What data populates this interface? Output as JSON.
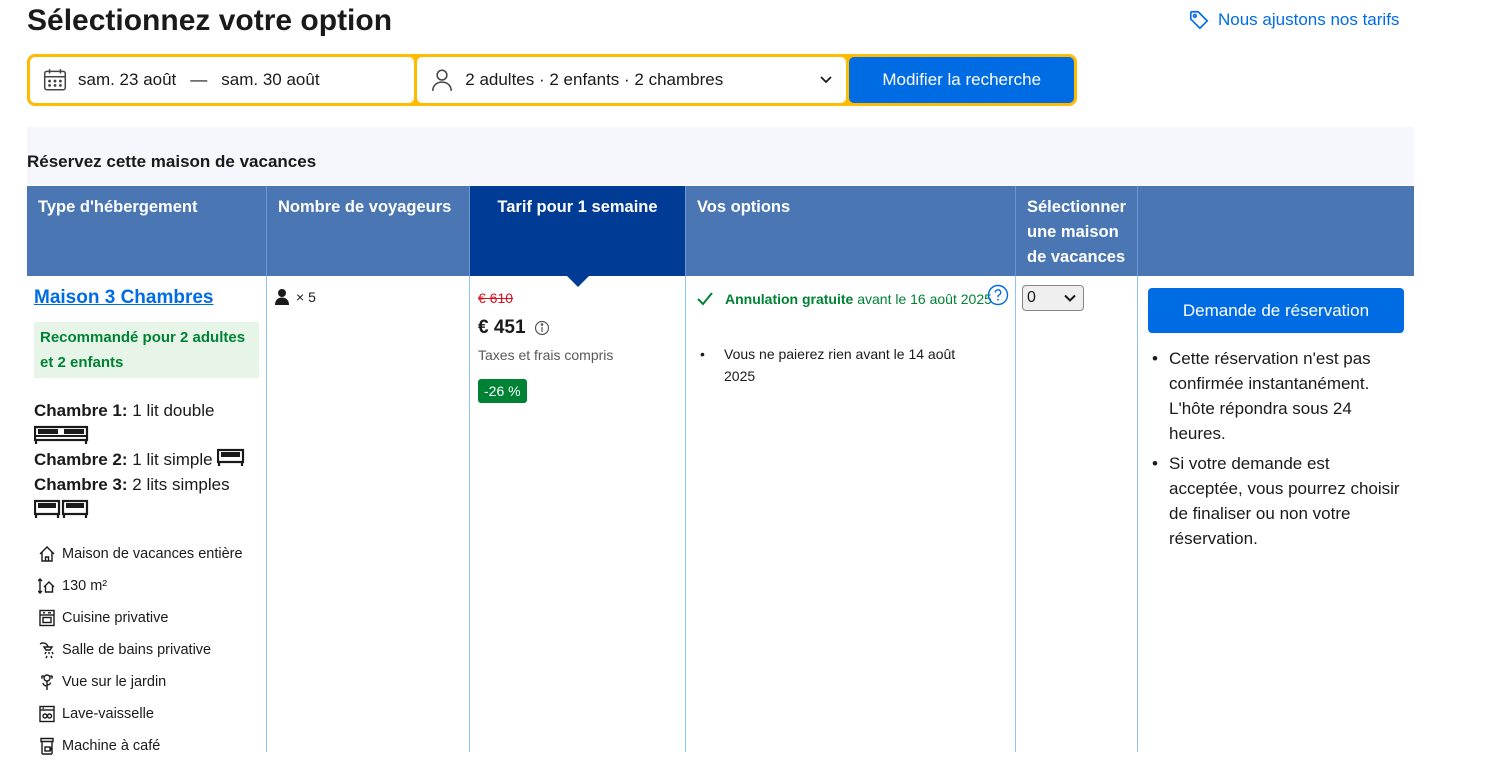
{
  "page": {
    "title": "Sélectionnez votre option",
    "price_link": "Nous ajustons nos tarifs"
  },
  "search": {
    "checkin": "sam. 23 août",
    "separator": "—",
    "checkout": "sam. 30 août",
    "guests": "2 adultes · 2 enfants · 2 chambres",
    "button": "Modifier la recherche"
  },
  "section": {
    "title": "Réservez cette maison de vacances"
  },
  "table": {
    "headers": [
      "Type d'hébergement",
      "Nombre de voyageurs",
      "Tarif pour 1 semaine",
      "Vos options",
      "Sélectionner une maison de vacances",
      ""
    ],
    "row": {
      "name": "Maison 3 Chambres",
      "recommendation": "Recommandé pour 2 adultes et 2 enfants",
      "rooms": [
        {
          "label": "Chambre 1:",
          "beds": "1 lit double"
        },
        {
          "label": "Chambre 2:",
          "beds": "1 lit simple"
        },
        {
          "label": "Chambre 3:",
          "beds": "2 lits simples"
        }
      ],
      "facilities": [
        {
          "icon": "house-icon",
          "label": "Maison de vacances entière"
        },
        {
          "icon": "area-icon",
          "label": "130 m²"
        },
        {
          "icon": "kitchen-icon",
          "label": "Cuisine privative"
        },
        {
          "icon": "shower-icon",
          "label": "Salle de bains privative"
        },
        {
          "icon": "flower-icon",
          "label": "Vue sur le jardin"
        },
        {
          "icon": "dishwasher-icon",
          "label": "Lave-vaisselle"
        },
        {
          "icon": "coffee-machine-icon",
          "label": "Machine à café"
        }
      ],
      "occupancy": "× 5",
      "old_price": "€ 610",
      "price": "€ 451",
      "tax_note": "Taxes et frais compris",
      "discount": "-26 %",
      "cancel_bold": "Annulation gratuite",
      "cancel_rest": " avant le 16 août 2025",
      "pay_note": "Vous ne paierez rien avant le 14 août 2025",
      "select_value": "0",
      "book_button": "Demande de réservation",
      "notes": [
        "Cette réservation n'est pas confirmée instantanément. L'hôte répondra sous 24 heures.",
        "Si votre demande est acceptée, vous pourrez choisir de finaliser ou non votre réservation."
      ]
    }
  },
  "colors": {
    "brand_blue": "#006ce4",
    "header_blue": "#4b76b4",
    "active_header": "#003b95",
    "search_border": "#febb02",
    "green": "#008234",
    "red": "#d4111e"
  }
}
